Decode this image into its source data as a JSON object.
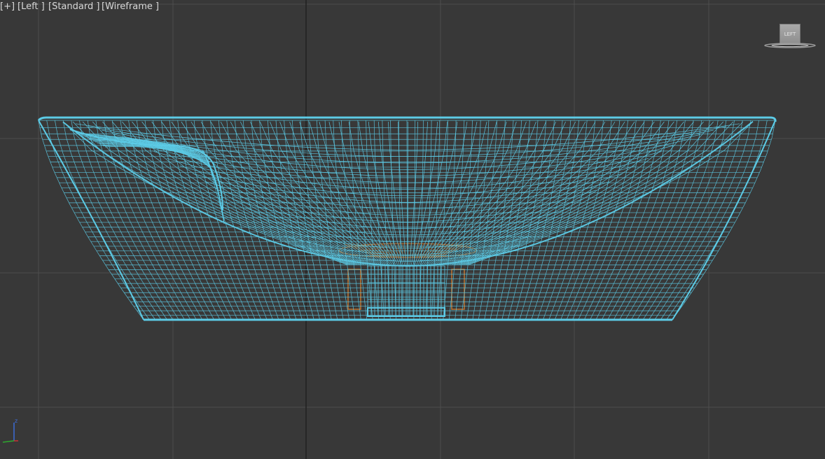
{
  "viewport": {
    "labels": {
      "plus": "[+]",
      "view": "[Left ]",
      "shading": "[Standard ]",
      "mode": "[Wireframe ]"
    },
    "viewcube_face": "LEFT",
    "axis_labels": {
      "z": "z"
    }
  },
  "colors": {
    "background": "#383838",
    "grid": "#4d4d4d",
    "grid_major": "#202020",
    "mesh_primary": "#5ccbe6",
    "mesh_secondary": "#c0722e",
    "axis_z": "#3c6cd8",
    "axis_y": "#2ea82e",
    "axis_x": "#c83232"
  },
  "icons": {
    "viewcube": "viewcube-left-icon",
    "axis": "axis-tripod-icon"
  }
}
